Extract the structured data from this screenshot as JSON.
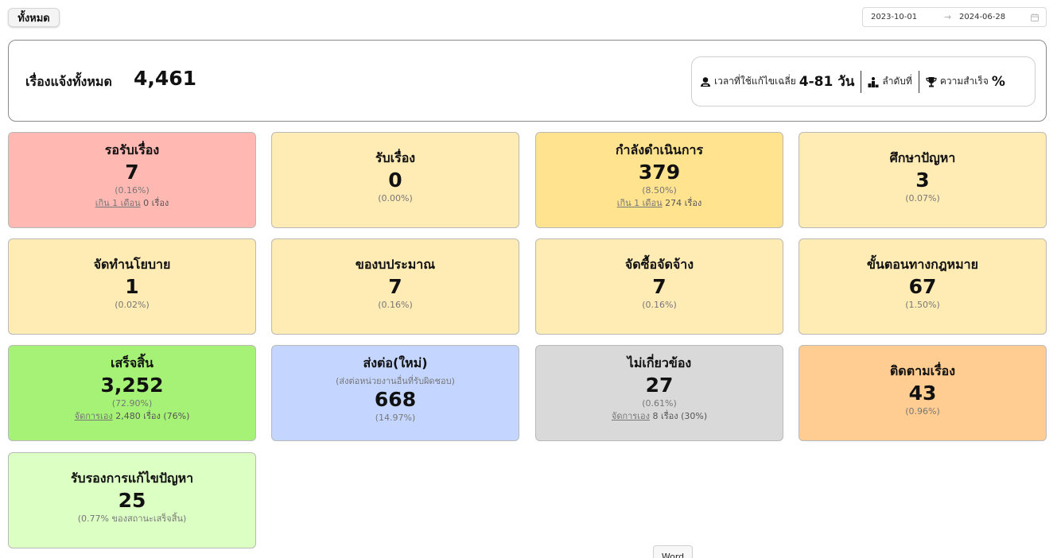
{
  "filter": {
    "label": "ทั้งหมด"
  },
  "date_range": {
    "start": "2023-10-01",
    "arrow": "→",
    "end": "2024-06-28"
  },
  "summary": {
    "label": "เรื่องแจ้งทั้งหมด",
    "total": "4,461",
    "stats": {
      "avg_time_label": "เวลาที่ใช้แก้ไขเฉลี่ย",
      "avg_time_value": "4-81 วัน",
      "rank_label": "ลำดับที่",
      "success_label": "ความสำเร็จ",
      "success_value": "%"
    }
  },
  "cards": [
    {
      "title": "รอรับเรื่อง",
      "value": "7",
      "pct": "(0.16%)",
      "extra_link": "เกิน 1 เดือน",
      "extra_text": " 0 เรื่อง",
      "color": "#ffb9b2"
    },
    {
      "title": "รับเรื่อง",
      "value": "0",
      "pct": "(0.00%)",
      "color": "#ffebb4"
    },
    {
      "title": "กำลังดำเนินการ",
      "value": "379",
      "pct": "(8.50%)",
      "extra_link": "เกิน 1 เดือน",
      "extra_text": " 274 เรื่อง",
      "color": "#ffe38f"
    },
    {
      "title": "ศึกษาปัญหา",
      "value": "3",
      "pct": "(0.07%)",
      "color": "#ffebb4"
    },
    {
      "title": "จัดทำนโยบาย",
      "value": "1",
      "pct": "(0.02%)",
      "color": "#ffebb4"
    },
    {
      "title": "ของบประมาณ",
      "value": "7",
      "pct": "(0.16%)",
      "color": "#ffebb4"
    },
    {
      "title": "จัดซื้อจัดจ้าง",
      "value": "7",
      "pct": "(0.16%)",
      "color": "#ffebb4"
    },
    {
      "title": "ขั้นตอนทางกฎหมาย",
      "value": "67",
      "pct": "(1.50%)",
      "color": "#ffebb4"
    },
    {
      "title": "เสร็จสิ้น",
      "value": "3,252",
      "pct": "(72.90%)",
      "extra_link": "จัดการเอง",
      "extra_text": " 2,480 เรื่อง (76%)",
      "color": "#a5f276"
    },
    {
      "title": "ส่งต่อ(ใหม่)",
      "subtitle": "(ส่งต่อหน่วยงานอื่นที่รับผิดชอบ)",
      "value": "668",
      "pct": "(14.97%)",
      "color": "#c4d6ff"
    },
    {
      "title": "ไม่เกี่ยวข้อง",
      "value": "27",
      "pct": "(0.61%)",
      "extra_link": "จัดการเอง",
      "extra_text": " 8 เรื่อง (30%)",
      "color": "#d9d9d9"
    },
    {
      "title": "ติดตามเรื่อง",
      "value": "43",
      "pct": "(0.96%)",
      "color": "#ffcc91"
    },
    {
      "title": "รับรองการแก้ไขปัญหา",
      "value": "25",
      "pct": "(0.77% ของสถานะเสร็จสิ้น)",
      "color": "#dcffc4"
    }
  ],
  "word_tab": {
    "label": "Word"
  }
}
